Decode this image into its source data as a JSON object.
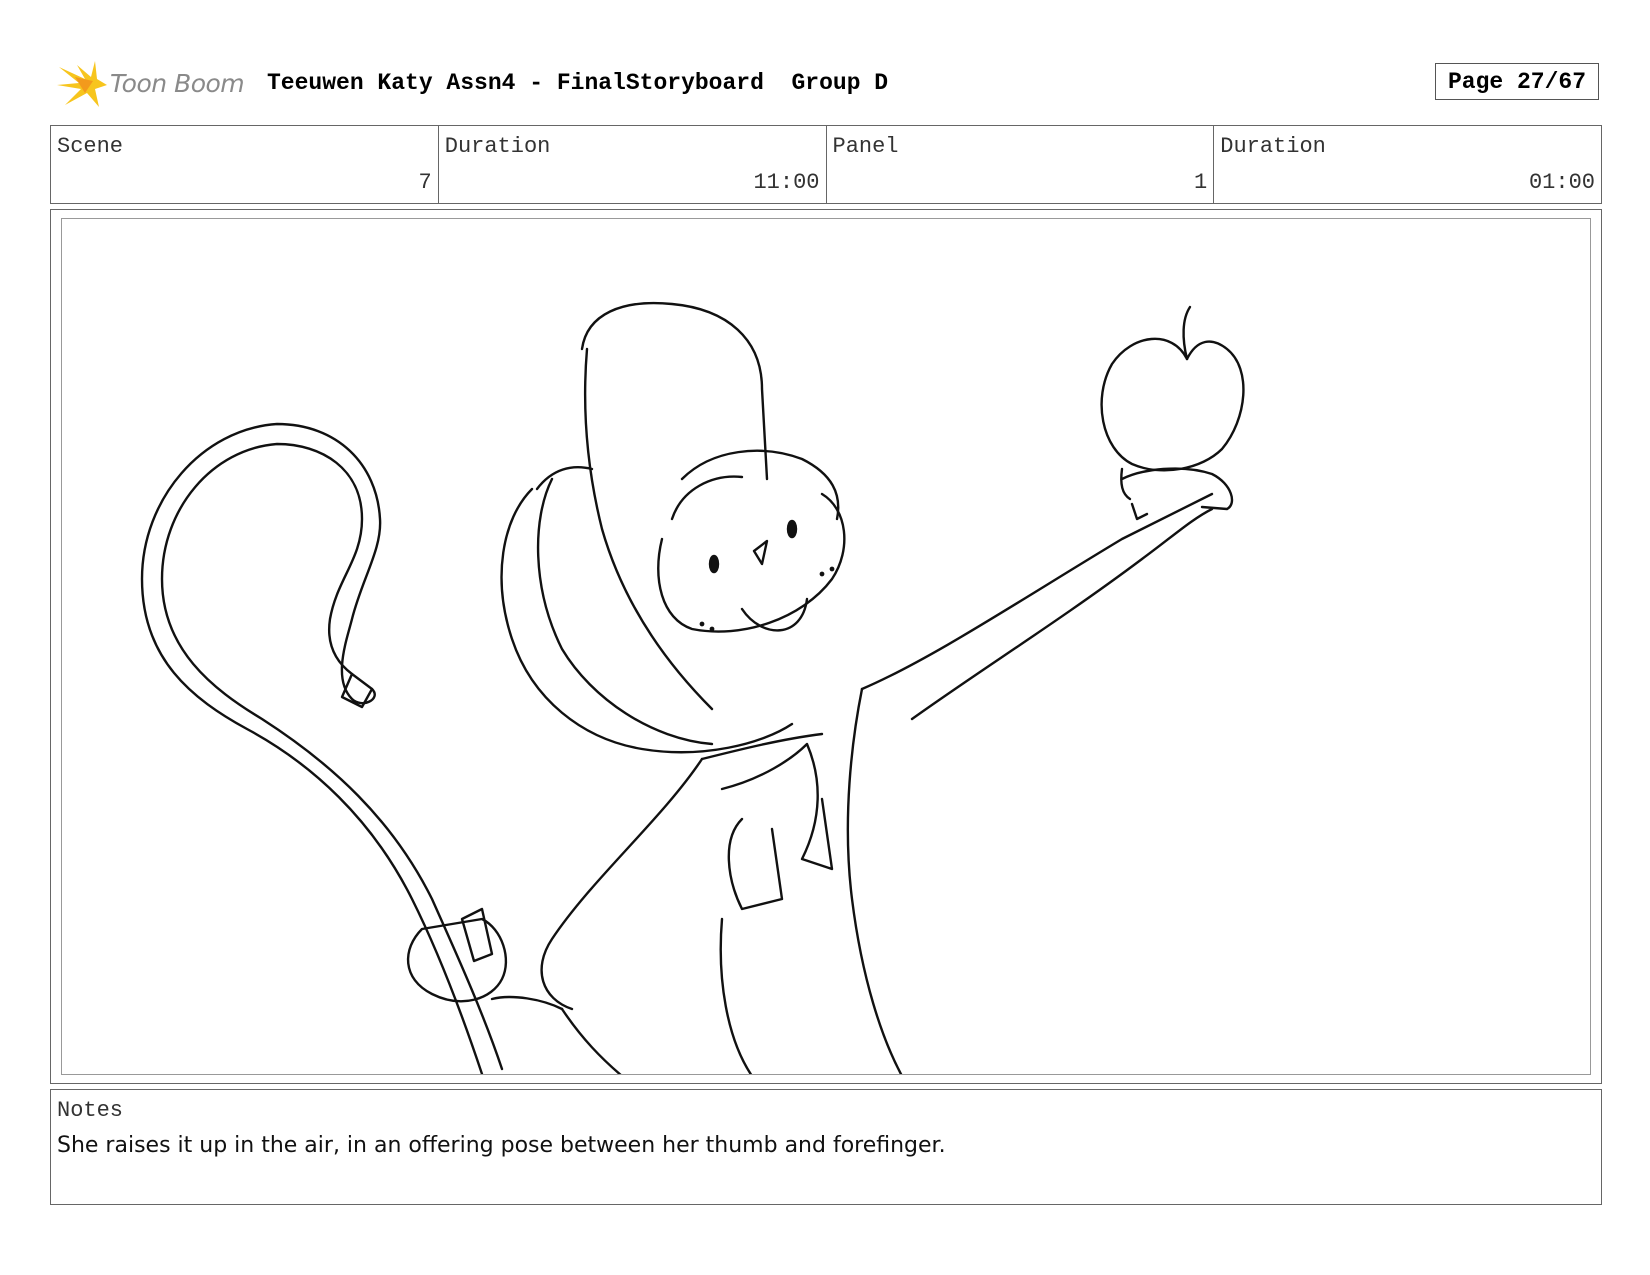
{
  "header": {
    "logo_text": "Toon Boom",
    "title": "Teeuwen Katy Assn4 - FinalStoryboard  Group D",
    "page": "Page 27/67"
  },
  "info": {
    "scene_label": "Scene",
    "scene_value": "7",
    "scene_duration_label": "Duration",
    "scene_duration_value": "11:00",
    "panel_label": "Panel",
    "panel_value": "1",
    "panel_duration_label": "Duration",
    "panel_duration_value": "01:00"
  },
  "notes": {
    "label": "Notes",
    "text": "She raises it up in the air, in an offering pose between her thumb and forefinger."
  },
  "colors": {
    "logo_yellow": "#f7c51d",
    "logo_orange": "#f39a1c",
    "border": "#666666",
    "sketch_line": "#111111"
  }
}
